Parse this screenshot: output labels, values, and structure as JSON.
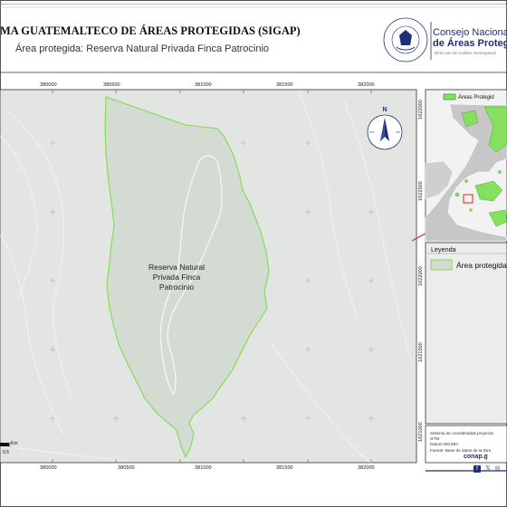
{
  "header": {
    "title": "MA GUATEMALTECO DE ÁREAS PROTEGIDAS  (SIGAP)",
    "subtitle": "Área protegida: Reserva Natural Privada Finca Patrocinio"
  },
  "logo": {
    "seal_text": "GOBIERNO DE LA REPÚBLICA DE GUATEMALA",
    "org_line1": "Consejo Nacional",
    "org_line2": "de Áreas Proteg",
    "department": "Dirección de Análisis Geoespacial"
  },
  "map": {
    "x_ticks_top": [
      "380000",
      "380500",
      "381000",
      "381500",
      "382000"
    ],
    "x_ticks_bottom": [
      "380000",
      "380500",
      "381000",
      "381500",
      "382000"
    ],
    "y_ticks": [
      "1622000",
      "1622500",
      "1622000",
      "1621500",
      "1621000"
    ],
    "protected_area_label": [
      "Reserva Natural",
      "Privada Finca",
      "Patrocinio"
    ],
    "north_label": "N",
    "scale": {
      "unit": "Km",
      "value": "0.5"
    },
    "colors": {
      "background": "#e3e5e2",
      "area_fill": "#d4dbd2",
      "area_border": "#7fdc4c",
      "grid": "#b7bab6"
    }
  },
  "inset": {
    "legend_label": "Áreas Protegid",
    "colors": {
      "land": "#c7c7c7",
      "protected": "#86e060",
      "highlight": "#e0202a"
    }
  },
  "legend": {
    "title": "Leyenda",
    "item_label": "Área protegida"
  },
  "info": {
    "lines": [
      "Sistema de coordenadas proyecta",
      "GTM",
      "Datum WGS84",
      "Fuente: Base de datos de la Dire"
    ]
  },
  "footer": {
    "website": "conap.g",
    "social_icons": [
      "facebook-icon",
      "x-icon",
      "instagram-icon"
    ]
  }
}
